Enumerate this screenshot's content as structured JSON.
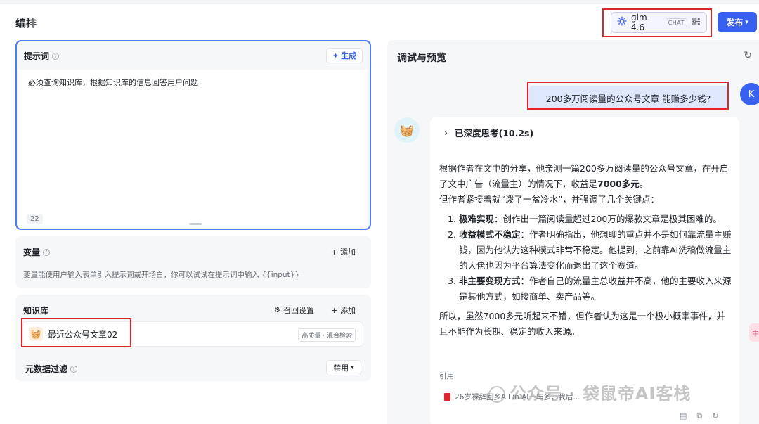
{
  "header": {
    "title": "编排",
    "model_name": "glm-4.6",
    "model_tag": "CHAT",
    "publish_label": "发布"
  },
  "prompt": {
    "title": "提示词",
    "generate_label": "生成",
    "text": "必须查询知识库，根据知识库的信息回答用户问题",
    "char_count": "22"
  },
  "variables": {
    "title": "变量",
    "add_label": "添加",
    "description": "变量能使用户输入表单引入提示词或开场白，你可以试试在提示词中输入 {{input}}"
  },
  "knowledge": {
    "title": "知识库",
    "recall_label": "召回设置",
    "add_label": "添加",
    "item_name": "最近公众号文章02",
    "item_tag": "高质量 · 混合检索"
  },
  "metadata": {
    "title": "元数据过滤",
    "select_value": "禁用"
  },
  "preview": {
    "title": "调试与预览",
    "user_message": "200多万阅读量的公众号文章 能赚多少钱?",
    "user_avatar": "K",
    "think_label": "已深度思考(10.2s)",
    "para1_a": "根据作者在文中的分享，他亲测一篇200多万阅读量的公众号文章，在开启了文中广告（流量主）的情况下，收益是",
    "para1_b": "7000多元",
    "para1_c": "。",
    "para2": "但作者紧接着就“泼了一盆冷水”，并强调了几个关键点：",
    "points": [
      {
        "bold": "极难实现",
        "text": "：创作出一篇阅读量超过200万的爆款文章是极其困难的。"
      },
      {
        "bold": "收益模式不稳定",
        "text": "：作者明确指出，他想聊的重点并不是如何靠流量主赚钱，因为他认为这种模式非常不稳定。他提到，之前靠AI洗稿做流量主的大佬也因为平台算法变化而退出了这个赛道。"
      },
      {
        "bold": "非主要变现方式",
        "text": "：作者自己的流量主总收益并不高，他的主要收入来源是其他方式，如接商单、卖产品等。"
      }
    ],
    "conclusion": "所以，虽然7000多元听起来不错，但作者认为这是一个极小概率事件，并且不能作为长期、稳定的收入来源。",
    "citation_label": "引用",
    "citation_item": "26岁裸辞回乡All in AI一年多，我后..."
  },
  "watermark": "公众号 · 袋鼠帝AI客栈",
  "side_badge": "中",
  "colors": {
    "accent": "#3861ef",
    "highlight_box": "#e0242c",
    "user_bubble": "#dfe7fd"
  }
}
